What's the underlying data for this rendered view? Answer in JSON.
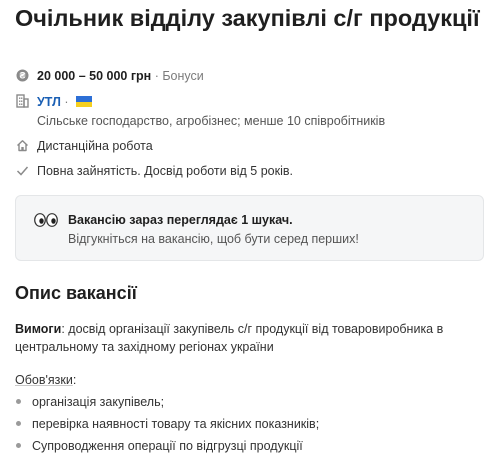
{
  "job": {
    "title": "Очільник відділу закупівлі с/г продукції",
    "salary": "20 000 – 50 000 грн",
    "salary_sep": " · ",
    "salary_extra": "Бонуси",
    "company_name": "УТЛ",
    "company_sep": " · ",
    "company_description": "Сільське господарство, агробізнес; менше 10 співробітників",
    "remote": "Дистанційна робота",
    "employment": "Повна зайнятість. Досвід роботи від 5 років."
  },
  "notice": {
    "title": "Вакансію зараз переглядає 1 шукач.",
    "subtitle": "Відгукніться на вакансію, щоб бути серед перших!"
  },
  "description": {
    "heading": "Опис вакансії",
    "requirements_label": "Вимоги",
    "requirements_text": ": досвід організації закупівель с/г продукції від товаровиробника в центральному та західному регіонах україни",
    "duties_label": "Обов'язки",
    "duties_colon": ":",
    "duties": [
      "організація закупівель;",
      "перевірка наявності товару та якісних показників;",
      "Супроводження операції по відгрузці продукції"
    ]
  },
  "icons": {
    "salary": "currency-coin-icon",
    "company": "building-icon",
    "remote": "home-icon",
    "employment": "check-icon",
    "notice": "eyes-icon",
    "flag": "ukraine-flag-icon"
  },
  "colors": {
    "link": "#1a5fb4",
    "notice_bg": "#f5f6f7",
    "flag_blue": "#2d6fd6",
    "flag_yellow": "#f5cf1f"
  }
}
